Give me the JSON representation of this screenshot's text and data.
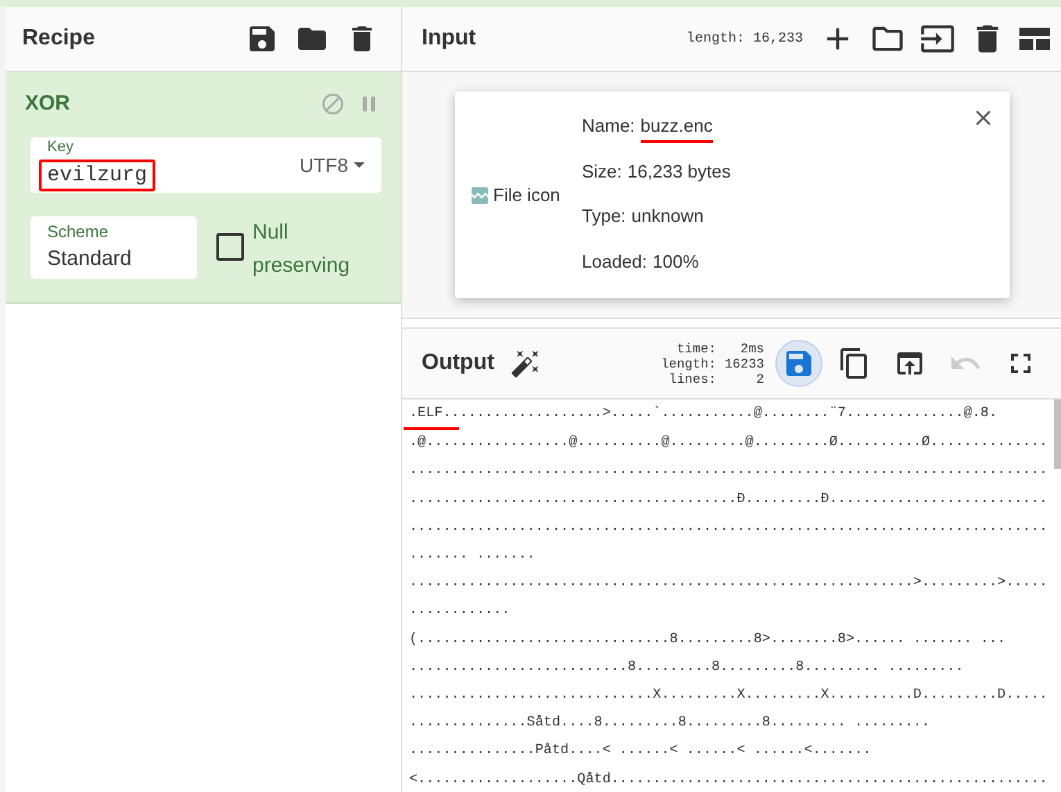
{
  "recipe": {
    "title": "Recipe",
    "buttons": [
      {
        "kind": "save"
      },
      {
        "kind": "load"
      },
      {
        "kind": "clear"
      }
    ],
    "operation": {
      "name": "XOR",
      "buttons": [
        {
          "kind": "disable"
        },
        {
          "kind": "pause"
        }
      ],
      "key": {
        "label": "Key",
        "value": "evilzurg",
        "encoding": "UTF8",
        "annotated": true
      },
      "scheme": {
        "label": "Scheme",
        "value": "Standard"
      },
      "option": {
        "label": "Null preserving",
        "checked": false
      }
    }
  },
  "input": {
    "title": "Input",
    "length": "length: 16,233",
    "buttons": [
      {
        "kind": "add"
      },
      {
        "kind": "open-folder"
      },
      {
        "kind": "open-file"
      },
      {
        "kind": "clear"
      },
      {
        "kind": "layout"
      }
    ],
    "file": {
      "icon_alt": "File icon",
      "details": [
        {
          "label": "Name:",
          "value": "buzz.enc",
          "annotated": true
        },
        {
          "label": "Size:",
          "value": "16,233 bytes",
          "annotated": false
        },
        {
          "label": "Type:",
          "value": "unknown",
          "annotated": false
        },
        {
          "label": "Loaded:",
          "value": "100%",
          "annotated": false
        }
      ]
    }
  },
  "output": {
    "title": "Output",
    "stats": [
      {
        "label": "time:",
        "value": "2ms"
      },
      {
        "label": "length:",
        "value": "16233"
      },
      {
        "label": "lines:",
        "value": "2"
      }
    ],
    "buttons": [
      {
        "kind": "save",
        "highlighted": true,
        "disabled": false
      },
      {
        "kind": "copy",
        "highlighted": false,
        "disabled": false
      },
      {
        "kind": "replace-input",
        "highlighted": false,
        "disabled": false
      },
      {
        "kind": "undo",
        "highlighted": false,
        "disabled": true
      },
      {
        "kind": "fullscreen",
        "highlighted": false,
        "disabled": false
      }
    ],
    "annotated": true,
    "lines": [
      ".ELF...................>.....`...........@........¨7..............@.8.",
      ".@.................@..........@.........@.........Ø..........Ø..............",
      "............................................................................",
      ".......................................Đ.........Đ..........................",
      "............................................................................",
      "....... .......",
      "............................................................>.........>.....",
      "............",
      "(..............................8.........8>........8>...... ....... ...",
      "..........................8.........8.........8......... .........",
      ".............................X.........X.........X..........D.........D.....",
      "..............Såtd....8.........8.........8......... .........",
      "...............Påtd....< ......< ......< ......<.......",
      "<...................Qåtd...................................................."
    ]
  }
}
